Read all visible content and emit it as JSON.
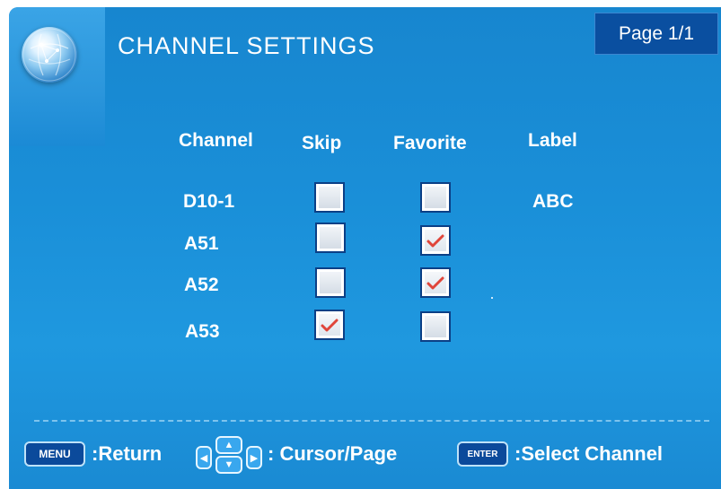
{
  "header": {
    "title": "CHANNEL SETTINGS",
    "page": "Page 1/1"
  },
  "columns": {
    "channel": "Channel",
    "skip": "Skip",
    "favorite": "Favorite",
    "label": "Label"
  },
  "rows": [
    {
      "channel": "D10-1",
      "skip": false,
      "favorite": false,
      "label": "ABC"
    },
    {
      "channel": "A51",
      "skip": false,
      "favorite": true,
      "label": ""
    },
    {
      "channel": "A52",
      "skip": false,
      "favorite": true,
      "label": ""
    },
    {
      "channel": "A53",
      "skip": true,
      "favorite": false,
      "label": ""
    }
  ],
  "footer": {
    "menu_key": "MENU",
    "return_text": ":Return",
    "cursor_text": ": Cursor/Page",
    "enter_key": "ENTER",
    "select_text": ":Select Channel"
  },
  "colors": {
    "background": "#1a8fd8",
    "accent": "#0b4a9b",
    "check": "#e0453a"
  }
}
